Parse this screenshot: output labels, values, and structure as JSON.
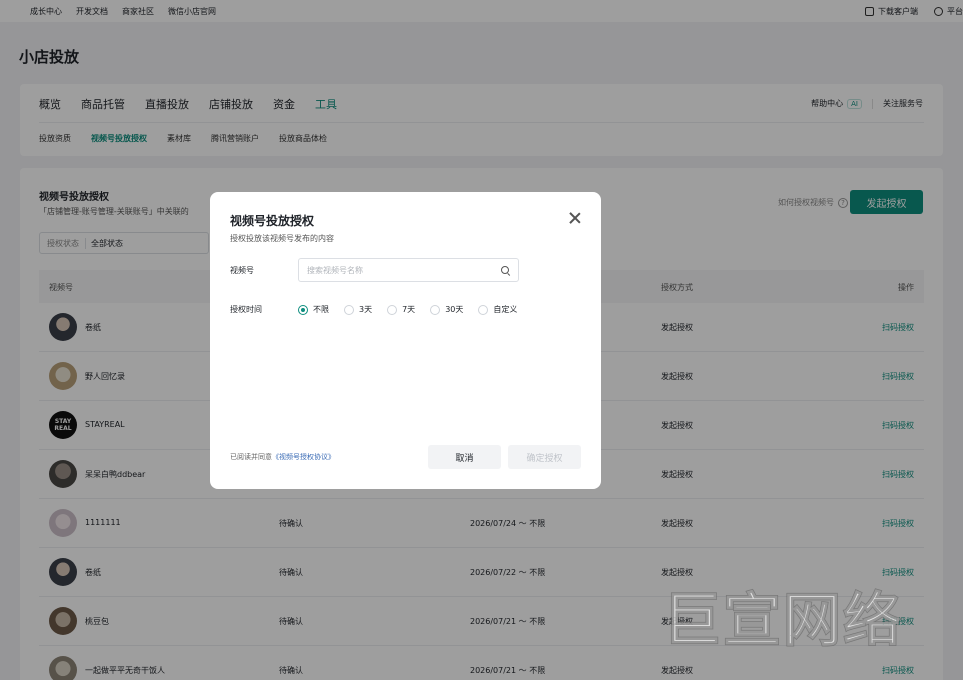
{
  "topbar": {
    "links": [
      "成长中心",
      "开发文档",
      "商家社区",
      "微信小店官网"
    ],
    "download": "下载客户端",
    "platform": "平台"
  },
  "page_title": "小店投放",
  "nav": {
    "tabs": [
      "概览",
      "商品托管",
      "直播投放",
      "店铺投放",
      "资金",
      "工具"
    ],
    "active_tab": "工具",
    "help": "帮助中心",
    "ai_badge": "AI",
    "follow": "关注服务号",
    "subtabs": [
      "投放资质",
      "视频号投放授权",
      "素材库",
      "腾讯营销账户",
      "投放商品体检"
    ]
  },
  "section": {
    "title": "视频号投放授权",
    "desc": "「店铺管理-账号管理-关联账号」中关联的",
    "how_link": "如何授权视频号",
    "launch_button": "发起授权",
    "filter_label": "授权状态",
    "filter_value": "全部状态"
  },
  "table": {
    "headers": [
      "视频号",
      "授权方式",
      "操作"
    ],
    "rows": [
      {
        "name": "卷纸",
        "status": "",
        "time": "",
        "method": "发起授权",
        "op": "扫码授权"
      },
      {
        "name": "野人回忆录",
        "status": "",
        "time": "",
        "method": "发起授权",
        "op": "扫码授权"
      },
      {
        "name": "STAYREAL",
        "status": "",
        "time": "",
        "method": "发起授权",
        "op": "扫码授权",
        "avatar_text": "STAY REAL"
      },
      {
        "name": "呆呆白鸭ddbear",
        "status": "",
        "time": "",
        "method": "发起授权",
        "op": "扫码授权"
      },
      {
        "name": "1111111",
        "status": "待确认",
        "time": "2026/07/24 ～ 不限",
        "method": "发起授权",
        "op": "扫码授权"
      },
      {
        "name": "卷纸",
        "status": "待确认",
        "time": "2026/07/22 ～ 不限",
        "method": "发起授权",
        "op": "扫码授权"
      },
      {
        "name": "桃豆包",
        "status": "待确认",
        "time": "2026/07/21 ～ 不限",
        "method": "发起授权",
        "op": "扫码授权"
      },
      {
        "name": "一起做平平无奇干饭人",
        "status": "待确认",
        "time": "2026/07/21 ～ 不限",
        "method": "发起授权",
        "op": "扫码授权"
      }
    ]
  },
  "modal": {
    "title": "视频号投放授权",
    "subtitle": "授权投放该视频号发布的内容",
    "account_label": "视频号",
    "search_placeholder": "搜索视频号名称",
    "search_value": "",
    "time_label": "授权时间",
    "options": [
      "不限",
      "3天",
      "7天",
      "30天",
      "自定义"
    ],
    "selected_option": "不限",
    "agree_text": "已阅读并同意",
    "agree_link": "《视频号授权协议》",
    "cancel": "取消",
    "confirm": "确定授权"
  },
  "watermark": "巨宣网络",
  "colors": {
    "accent": "#0e8e7f",
    "link": "#3a6bb5"
  }
}
